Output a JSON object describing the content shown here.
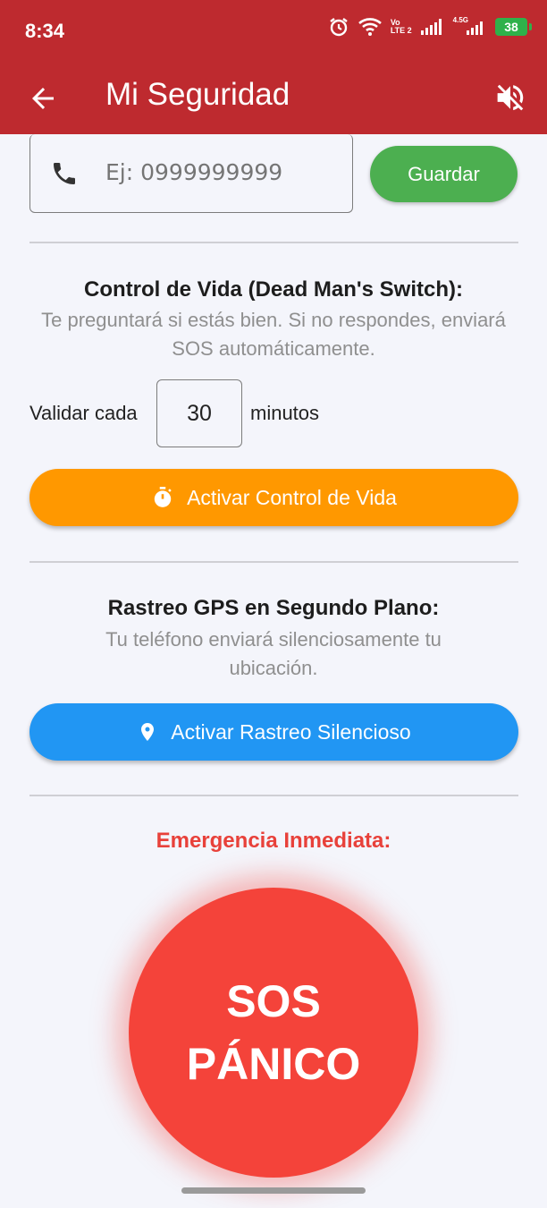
{
  "status_bar": {
    "time": "8:34",
    "volte_top": "Vo",
    "volte_bottom": "LTE 2",
    "network_small": "4.5G",
    "battery": "38"
  },
  "app_bar": {
    "title": "Mi Seguridad",
    "back_icon": "arrow-left-icon",
    "mute_icon": "volume-off-icon"
  },
  "contact": {
    "phone_placeholder": "Ej: 0999999999",
    "save_label": "Guardar"
  },
  "life_control": {
    "title": "Control de Vida (Dead Man's Switch):",
    "description": "Te preguntará si estás bien. Si no respondes, enviará SOS automáticamente.",
    "validate_label": "Validar cada",
    "minutes_value": "30",
    "minutes_label": "minutos",
    "button_label": "Activar Control de Vida",
    "button_icon": "timer-icon"
  },
  "gps": {
    "title": "Rastreo GPS en Segundo Plano:",
    "description": "Tu teléfono enviará silenciosamente tu ubicación.",
    "button_label": "Activar Rastreo Silencioso",
    "button_icon": "location-pin-icon"
  },
  "emergency": {
    "title": "Emergencia Inmediata:",
    "sos_line1": "SOS",
    "sos_line2": "PÁNICO"
  },
  "colors": {
    "app_bar": "#be2a2f",
    "save_button": "#4caf50",
    "life_button": "#ff9800",
    "gps_button": "#2196f3",
    "sos": "#f4433a"
  }
}
